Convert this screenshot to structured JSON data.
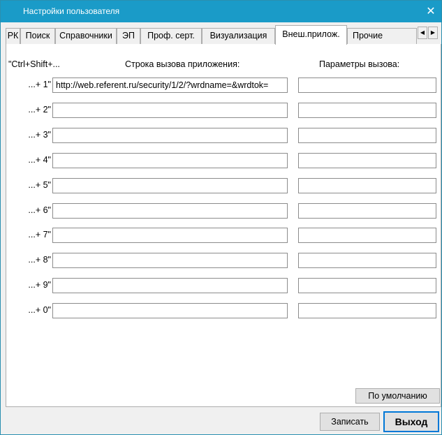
{
  "window": {
    "title": "Настройки пользователя",
    "close_glyph": "✕"
  },
  "tabs": [
    {
      "label": "РК"
    },
    {
      "label": "Поиск"
    },
    {
      "label": "Справочники"
    },
    {
      "label": "ЭП"
    },
    {
      "label": "Проф. серт."
    },
    {
      "label": "Визуализация"
    },
    {
      "label": "Внеш.прилож."
    },
    {
      "label": "Прочие"
    }
  ],
  "active_tab": "Внеш.прилож.",
  "tab_scroll": {
    "left_glyph": "◀",
    "right_glyph": "▶"
  },
  "headers": {
    "hotkey": "\"Ctrl+Shift+...",
    "command": "Строка вызова приложения:",
    "params": "Параметры вызова:"
  },
  "rows": [
    {
      "label": "...+ 1\"",
      "command": "http://web.referent.ru/security/1/2/?wrdname=&wrdtok=",
      "params": ""
    },
    {
      "label": "...+ 2\"",
      "command": "",
      "params": ""
    },
    {
      "label": "...+ 3\"",
      "command": "",
      "params": ""
    },
    {
      "label": "...+ 4\"",
      "command": "",
      "params": ""
    },
    {
      "label": "...+ 5\"",
      "command": "",
      "params": ""
    },
    {
      "label": "...+ 6\"",
      "command": "",
      "params": ""
    },
    {
      "label": "...+ 7\"",
      "command": "",
      "params": ""
    },
    {
      "label": "...+ 8\"",
      "command": "",
      "params": ""
    },
    {
      "label": "...+ 9\"",
      "command": "",
      "params": ""
    },
    {
      "label": "...+ 0\"",
      "command": "",
      "params": ""
    }
  ],
  "buttons": {
    "defaults": "По умолчанию",
    "save": "Записать",
    "exit": "Выход"
  },
  "colors": {
    "titlebar": "#1a9bc8",
    "panel": "#ffffff",
    "frame": "#f0f0f0"
  }
}
